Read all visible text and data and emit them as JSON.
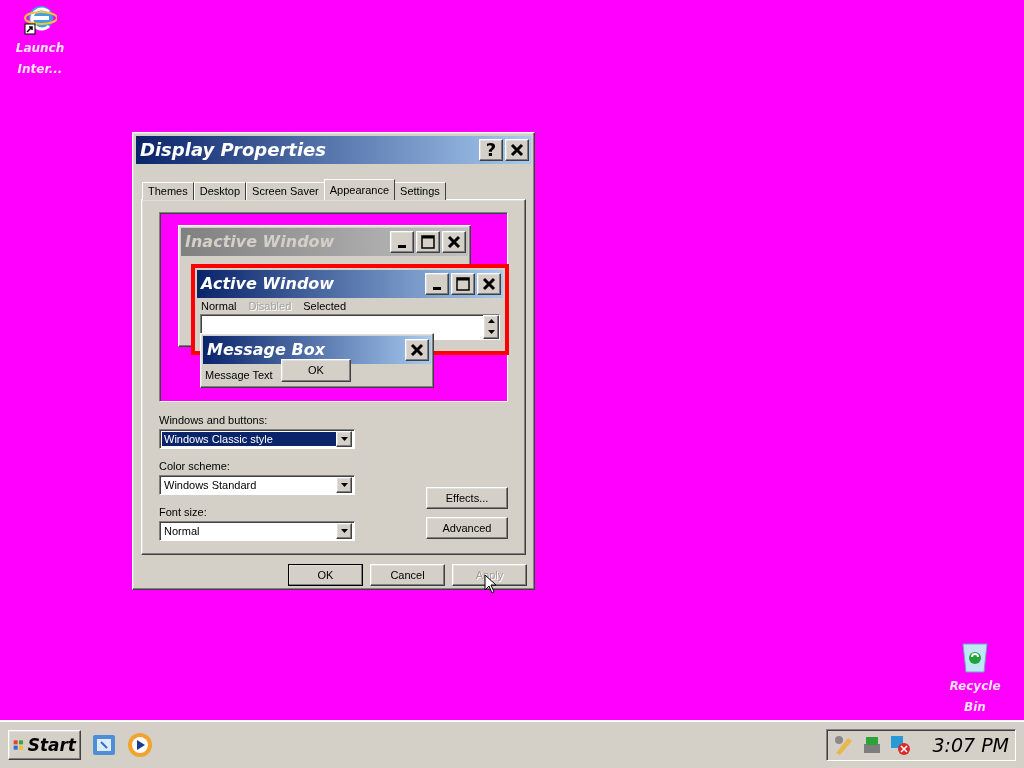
{
  "desktop_icons": [
    {
      "kind": "browser",
      "label": "Launch Inter..."
    },
    {
      "kind": "recycle",
      "label": "Recycle Bin"
    }
  ],
  "dialog": {
    "title": "Display Properties",
    "help_button": "?",
    "tabs": [
      {
        "label": "Themes",
        "selected": false
      },
      {
        "label": "Desktop",
        "selected": false
      },
      {
        "label": "Screen Saver",
        "selected": false
      },
      {
        "label": "Appearance",
        "selected": true
      },
      {
        "label": "Settings",
        "selected": false
      }
    ],
    "preview": {
      "inactive_title": "Inactive Window",
      "active_title": "Active Window",
      "menu": [
        {
          "label": "Normal",
          "disabled": false
        },
        {
          "label": "Disabled",
          "disabled": true
        },
        {
          "label": "Selected",
          "disabled": false
        }
      ],
      "message_box": {
        "title": "Message Box",
        "text": "Message Text",
        "button": "OK"
      }
    },
    "fields": [
      {
        "label": "Windows and buttons:",
        "value": "Windows Classic style",
        "selected": true
      },
      {
        "label": "Color scheme:",
        "value": "Windows Standard",
        "selected": false
      },
      {
        "label": "Font size:",
        "value": "Normal",
        "selected": false
      }
    ],
    "side_buttons": [
      "Effects...",
      "Advanced"
    ],
    "buttons": [
      {
        "label": "OK",
        "default": true,
        "disabled": false
      },
      {
        "label": "Cancel",
        "default": false,
        "disabled": false
      },
      {
        "label": "Apply",
        "default": false,
        "disabled": true
      }
    ]
  },
  "taskbar": {
    "start": "Start",
    "clock": "3:07 PM"
  }
}
